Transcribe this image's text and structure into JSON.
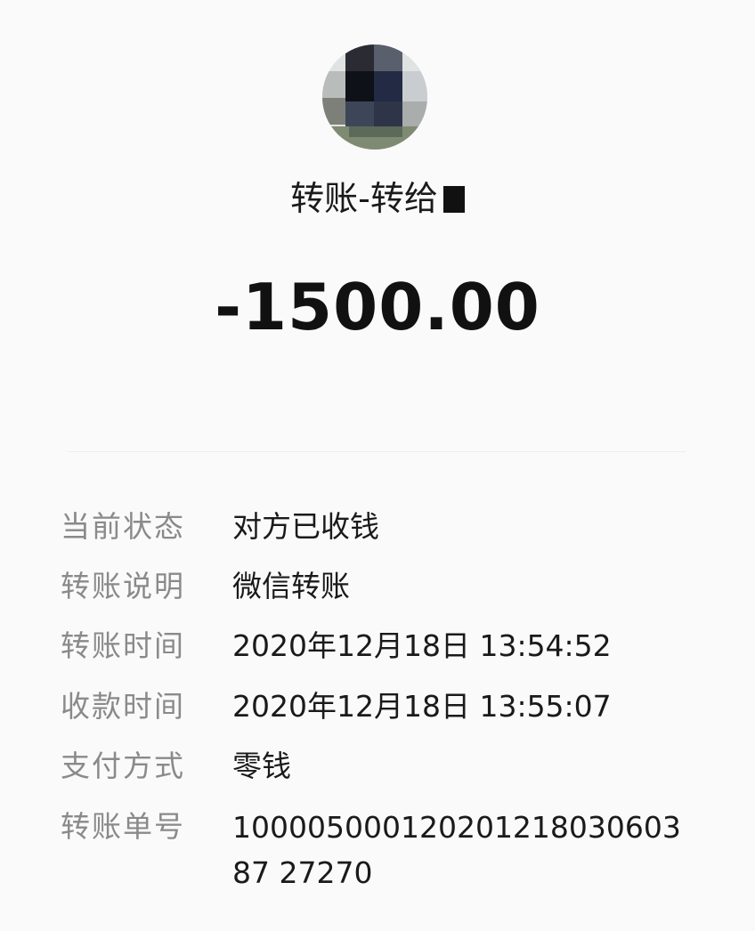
{
  "header": {
    "title": "转账-转给"
  },
  "amount": "-1500.00",
  "details": [
    {
      "label": "当前状态",
      "value": "对方已收钱"
    },
    {
      "label": "转账说明",
      "value": "微信转账"
    },
    {
      "label": "转账时间",
      "value": "2020年12月18日 13:54:52"
    },
    {
      "label": "收款时间",
      "value": "2020年12月18日 13:55:07"
    },
    {
      "label": "支付方式",
      "value": "零钱"
    },
    {
      "label": "转账单号",
      "value": "10000500012020121803060387 27270"
    }
  ]
}
